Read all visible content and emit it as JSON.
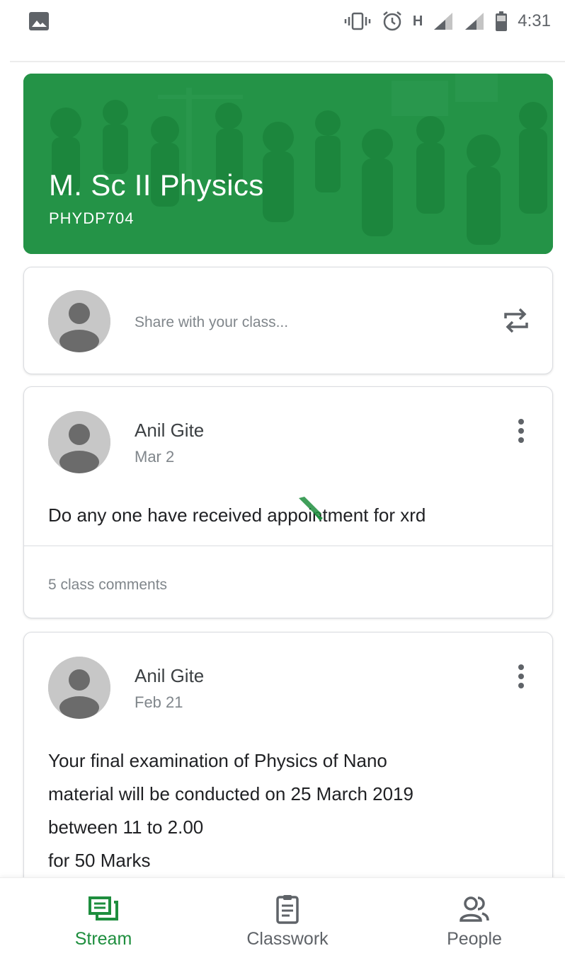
{
  "status_bar": {
    "time": "4:31",
    "network_type": "H",
    "icons": [
      "image-icon",
      "vibrate-icon",
      "alarm-icon",
      "signal-icon",
      "signal-icon",
      "battery-icon"
    ]
  },
  "class": {
    "name": "M. Sc II Physics",
    "code": "PHYDP704",
    "theme_color": "#1e8e3e"
  },
  "share": {
    "placeholder": "Share with your class..."
  },
  "posts": [
    {
      "author": "Anil Gite",
      "date": "Mar 2",
      "body": [
        "Do any one have received appointment for xrd"
      ],
      "comments": "5 class comments"
    },
    {
      "author": "Anil Gite",
      "date": "Feb 21",
      "body": [
        "Your final examination of Physics of Nano",
        "material will be conducted on 25 March 2019",
        "between 11 to 2.00",
        "for 50 Marks"
      ]
    }
  ],
  "nav": {
    "active": "Stream",
    "items": [
      {
        "label": "Stream",
        "icon": "stream-icon"
      },
      {
        "label": "Classwork",
        "icon": "classwork-icon"
      },
      {
        "label": "People",
        "icon": "people-icon"
      }
    ]
  }
}
